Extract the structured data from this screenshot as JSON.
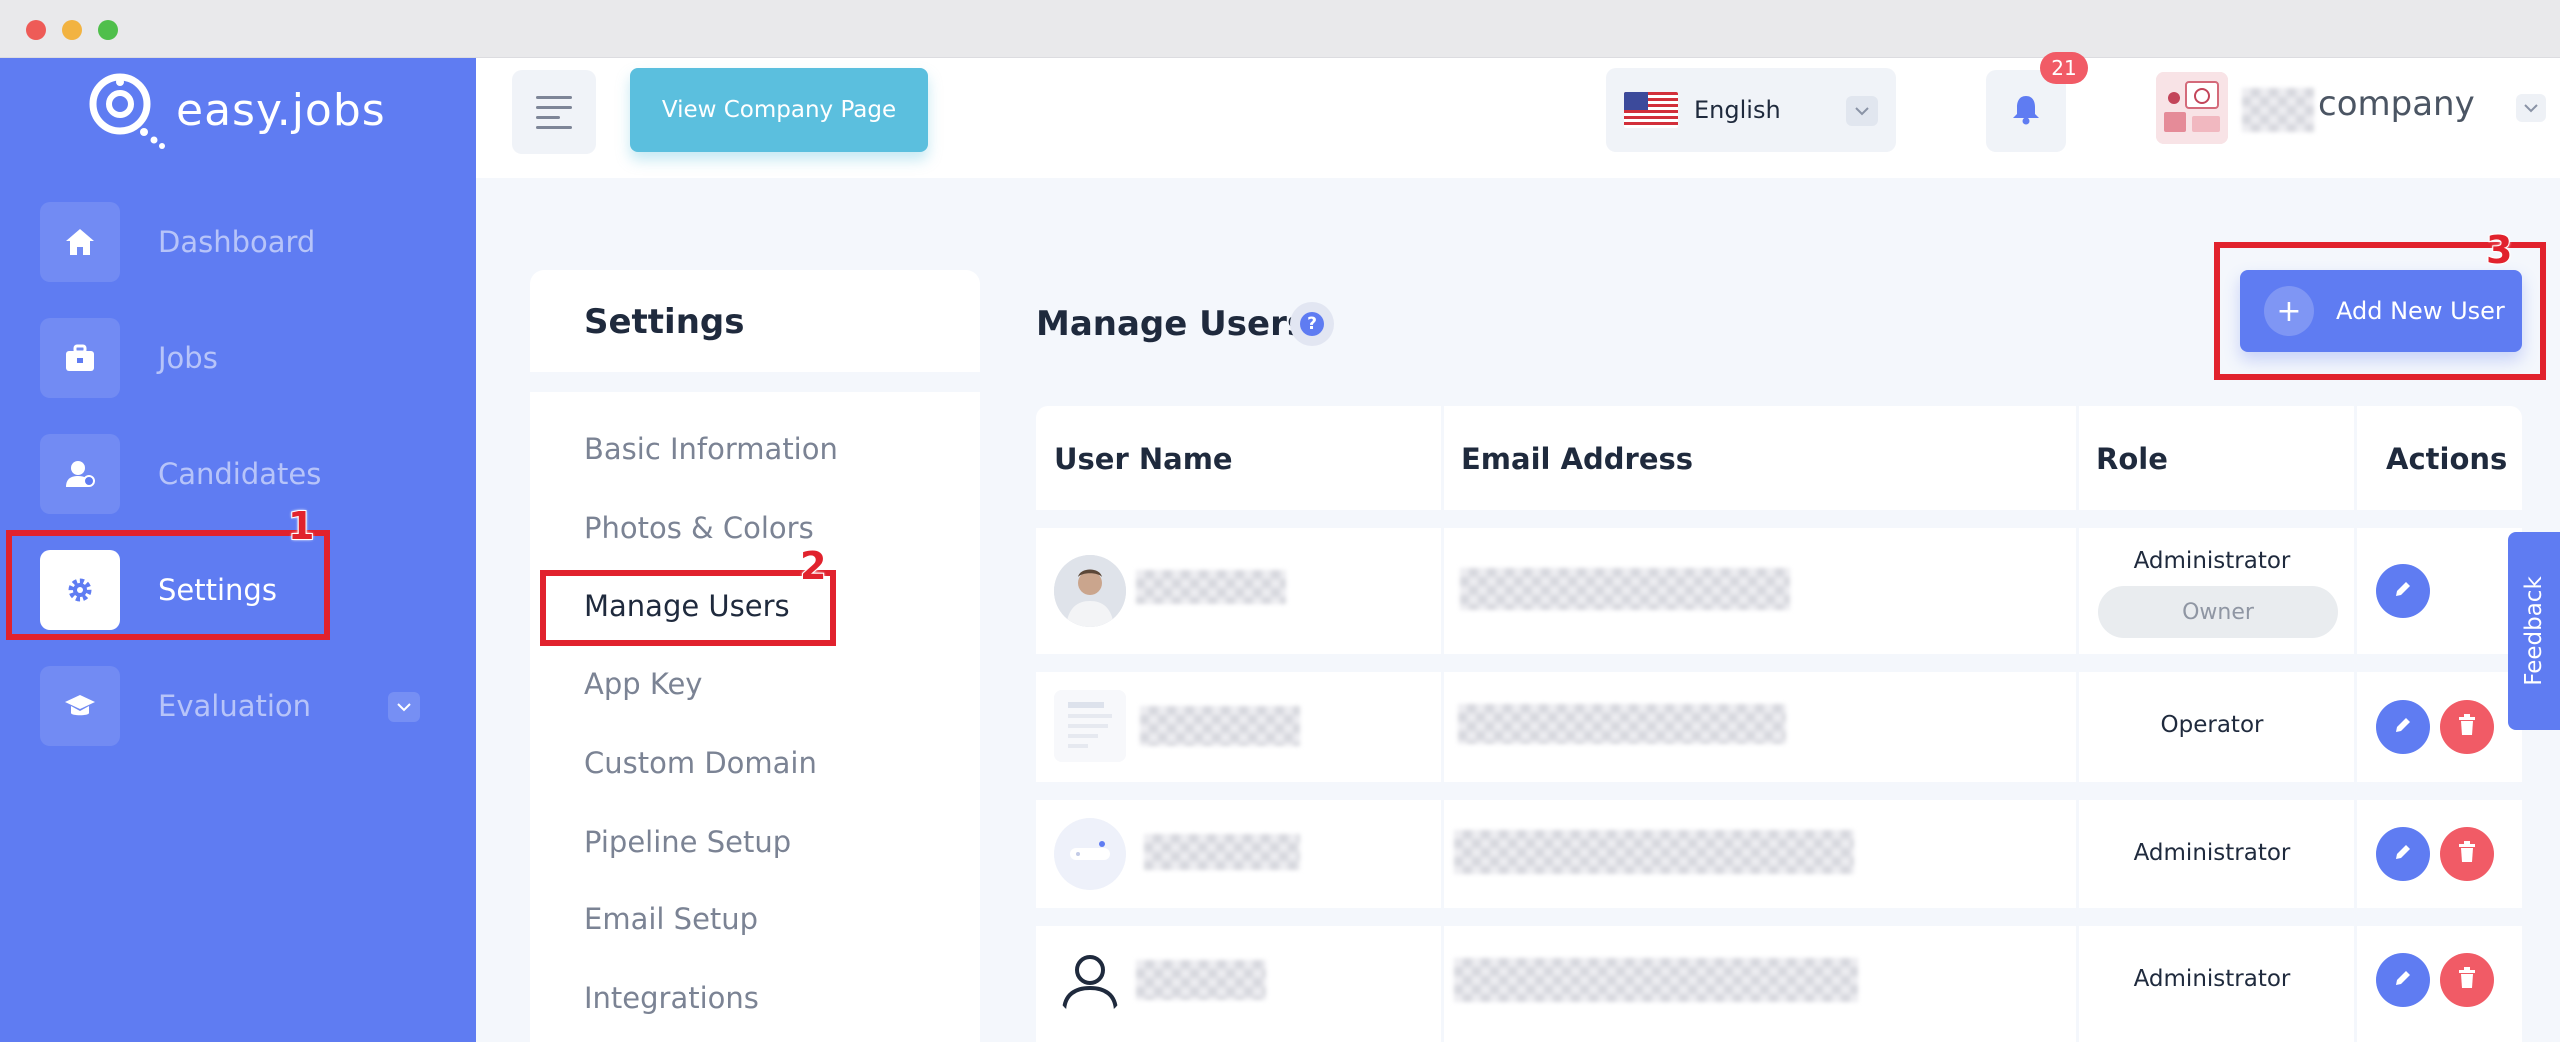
{
  "window": {
    "controls": [
      "close",
      "minimize",
      "maximize"
    ]
  },
  "brand": {
    "name": "easy.jobs",
    "accent": "#5f7cf2"
  },
  "sidebar": {
    "items": [
      {
        "label": "Dashboard",
        "icon": "home-icon"
      },
      {
        "label": "Jobs",
        "icon": "briefcase-icon"
      },
      {
        "label": "Candidates",
        "icon": "user-icon"
      },
      {
        "label": "Settings",
        "icon": "gear-icon",
        "active": true
      },
      {
        "label": "Evaluation",
        "icon": "graduation-cap-icon",
        "has_dropdown": true
      }
    ]
  },
  "topbar": {
    "view_company": "View Company Page",
    "language": "English",
    "notifications_count": "21",
    "company_name": "company"
  },
  "settings_menu": {
    "title": "Settings",
    "items": [
      "Basic Information",
      "Photos & Colors",
      "Manage Users",
      "App Key",
      "Custom Domain",
      "Pipeline Setup",
      "Email Setup",
      "Integrations"
    ],
    "active": "Manage Users"
  },
  "main": {
    "title": "Manage Users",
    "add_button": "Add New User",
    "table": {
      "headers": [
        "User Name",
        "Email Address",
        "Role",
        "Actions"
      ],
      "rows": [
        {
          "role": "Administrator",
          "badge": "Owner",
          "actions": [
            "edit"
          ]
        },
        {
          "role": "Operator",
          "actions": [
            "edit",
            "delete"
          ]
        },
        {
          "role": "Administrator",
          "actions": [
            "edit",
            "delete"
          ]
        },
        {
          "role": "Administrator",
          "actions": [
            "edit",
            "delete"
          ]
        }
      ]
    }
  },
  "feedback": "Feedback",
  "annotations": {
    "steps": [
      "1",
      "2",
      "3"
    ],
    "color": "#e1222d"
  }
}
